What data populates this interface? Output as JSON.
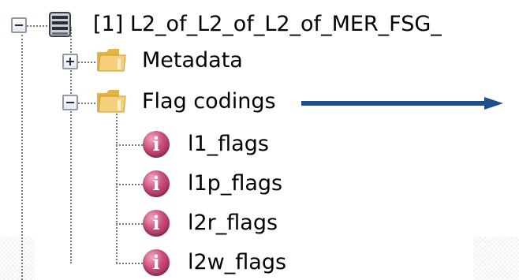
{
  "tree": {
    "root": {
      "label": "[1] L2_of_L2_of_L2_of_MER_FSG_",
      "icon": "database-icon",
      "expanded": true
    },
    "metadata": {
      "label": "Metadata",
      "icon": "folder-icon",
      "expanded": false
    },
    "flag_codings": {
      "label": "Flag codings",
      "icon": "folder-icon",
      "expanded": true,
      "children": [
        {
          "label": "l1_flags",
          "icon": "info-icon"
        },
        {
          "label": "l1p_flags",
          "icon": "info-icon"
        },
        {
          "label": "l2r_flags",
          "icon": "info-icon"
        },
        {
          "label": "l2w_flags",
          "icon": "info-icon"
        }
      ]
    }
  },
  "annotation": {
    "arrow_color": "#1f4e8c",
    "arrow_target": "Flag codings"
  }
}
